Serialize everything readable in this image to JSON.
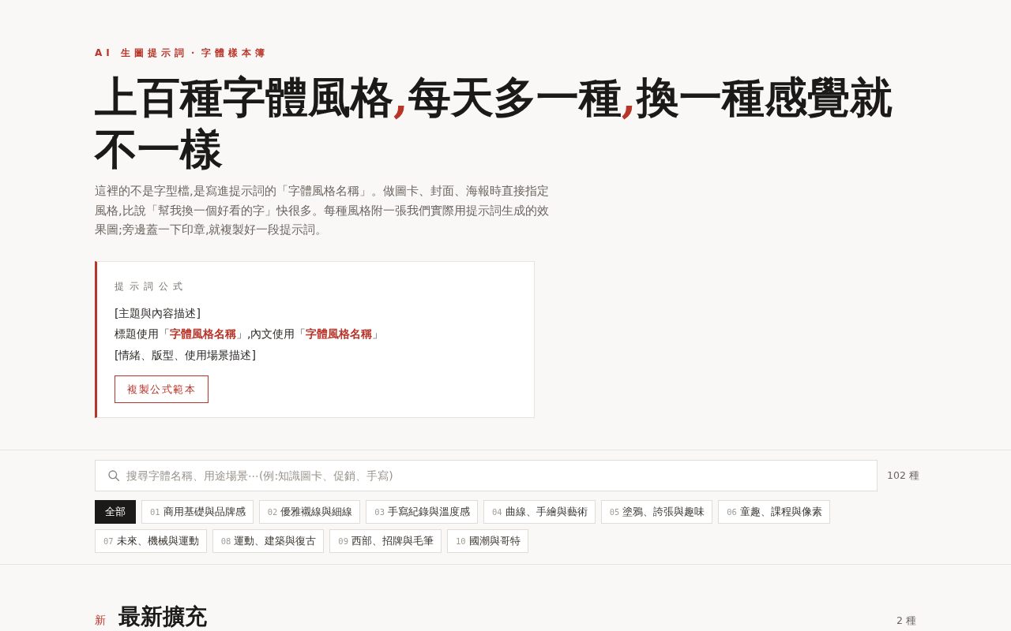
{
  "hero": {
    "eyebrow": "AI 生圖提示詞・字體樣本簿",
    "headline": [
      {
        "text": "上百種字體風格",
        "accent": false
      },
      {
        "text": ",",
        "accent": true
      },
      {
        "text": "每天多一種",
        "accent": false
      },
      {
        "text": ",",
        "accent": true
      },
      {
        "text": "換一種感覺就不一樣",
        "accent": false
      }
    ],
    "description": "這裡的不是字型檔,是寫進提示詞的「字體風格名稱」。做圖卡、封面、海報時直接指定風格,比說「幫我換一個好看的字」快很多。每種風格附一張我們實際用提示詞生成的效果圖;旁邊蓋一下印章,就複製好一段提示詞。"
  },
  "formula": {
    "label": "提示詞公式",
    "lines": [
      "[主題與內容描述]",
      "標題使用「**字體風格名稱**」,內文使用「**字體風格名稱**」",
      "[情緒、版型、使用場景描述]"
    ],
    "button": "複製公式範本"
  },
  "search": {
    "placeholder": "搜尋字體名稱、用途場景⋯(例:知識圖卡、促銷、手寫)",
    "count": "102 種"
  },
  "filters": [
    {
      "label": "全部",
      "selected": true
    },
    {
      "number": "01",
      "label": "商用基礎與品牌感",
      "selected": false
    },
    {
      "number": "02",
      "label": "優雅襯線與細線",
      "selected": false
    },
    {
      "number": "03",
      "label": "手寫紀錄與溫度感",
      "selected": false
    },
    {
      "number": "04",
      "label": "曲線、手繪與藝術",
      "selected": false
    },
    {
      "number": "05",
      "label": "塗鴉、誇張與趣味",
      "selected": false
    },
    {
      "number": "06",
      "label": "童趣、課程與像素",
      "selected": false
    },
    {
      "number": "07",
      "label": "未來、機械與運動",
      "selected": false
    },
    {
      "number": "08",
      "label": "運動、建築與復古",
      "selected": false
    },
    {
      "number": "09",
      "label": "西部、招牌與毛筆",
      "selected": false
    },
    {
      "number": "10",
      "label": "國潮與哥特",
      "selected": false
    }
  ],
  "section": {
    "badge": "新",
    "title": "最新擴充",
    "count": "2 種"
  }
}
